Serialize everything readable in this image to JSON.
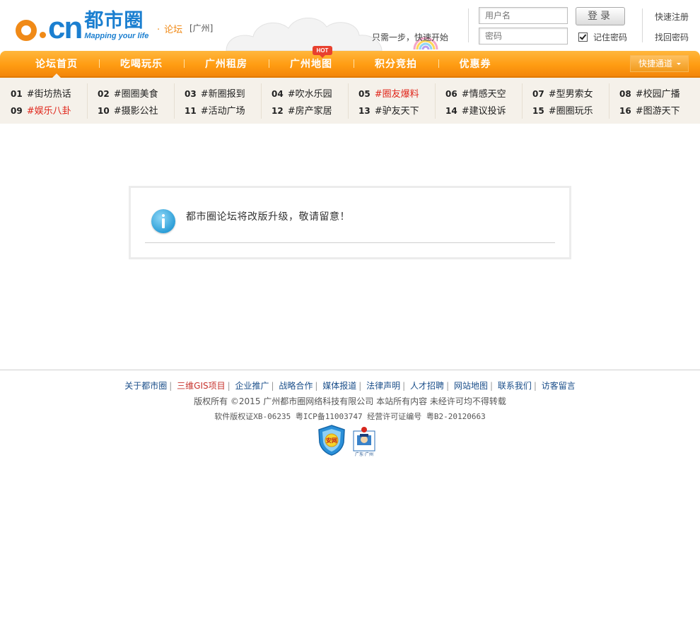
{
  "header": {
    "logo_slogan": "Mapping your life",
    "logo_name": "都市圈",
    "logo_domain": "o.cn",
    "forum_link": "论坛",
    "city": "[广州]",
    "tagline_prefix": "只需一步，",
    "tagline_link": "快速开始",
    "username_placeholder": "用户名",
    "password_placeholder": "密码",
    "login_label": "登录",
    "remember_label": "记住密码",
    "register_link": "快速注册",
    "recover_link": "找回密码"
  },
  "nav": {
    "items": [
      {
        "label": "论坛首页"
      },
      {
        "label": "吃喝玩乐"
      },
      {
        "label": "广州租房"
      },
      {
        "label": "广州地图"
      },
      {
        "label": "积分竞拍"
      },
      {
        "label": "优惠券"
      }
    ],
    "hot_badge": "HOT",
    "quick_access": "快捷通道"
  },
  "boards": [
    {
      "num": "01",
      "name": "#街坊热话",
      "highlight": false
    },
    {
      "num": "09",
      "name": "#娱乐八卦",
      "highlight": true
    },
    {
      "num": "02",
      "name": "#圈圈美食",
      "highlight": false
    },
    {
      "num": "10",
      "name": "#摄影公社",
      "highlight": false
    },
    {
      "num": "03",
      "name": "#新圈报到",
      "highlight": false
    },
    {
      "num": "11",
      "name": "#活动广场",
      "highlight": false
    },
    {
      "num": "04",
      "name": "#吹水乐园",
      "highlight": false
    },
    {
      "num": "12",
      "name": "#房产家居",
      "highlight": false
    },
    {
      "num": "05",
      "name": "#圈友爆料",
      "highlight": true
    },
    {
      "num": "13",
      "name": "#驴友天下",
      "highlight": false
    },
    {
      "num": "06",
      "name": "#情感天空",
      "highlight": false
    },
    {
      "num": "14",
      "name": "#建议投诉",
      "highlight": false
    },
    {
      "num": "07",
      "name": "#型男索女",
      "highlight": false
    },
    {
      "num": "15",
      "name": "#圈圈玩乐",
      "highlight": false
    },
    {
      "num": "08",
      "name": "#校园广播",
      "highlight": false
    },
    {
      "num": "16",
      "name": "#图游天下",
      "highlight": false
    }
  ],
  "notice": {
    "message": "都市圈论坛将改版升级，敬请留意！"
  },
  "footer": {
    "links": [
      {
        "label": "关于都市圈",
        "red": false
      },
      {
        "label": "三维GIS项目",
        "red": true
      },
      {
        "label": "企业推广",
        "red": false
      },
      {
        "label": "战略合作",
        "red": false
      },
      {
        "label": "媒体报道",
        "red": false
      },
      {
        "label": "法律声明",
        "red": false
      },
      {
        "label": "人才招聘",
        "red": false
      },
      {
        "label": "网站地图",
        "red": false
      },
      {
        "label": "联系我们",
        "red": false
      },
      {
        "label": "访客留言",
        "red": false
      }
    ],
    "copyright": "版权所有 ©2015 广州都市圈网络科技有限公司 本站所有内容 未经许可均不得转载",
    "license": "软件版权证XB-06235 粤ICP备11003747 经营许可证编号 粤B2-20120663",
    "badge_left": "安网",
    "badge_right": "广东·广州"
  },
  "colors": {
    "brand_orange": "#f08a17",
    "brand_blue": "#1b7fd0",
    "nav_orange": "#ff9c12",
    "highlight_red": "#e0261b",
    "link_blue": "#1a4e8a"
  }
}
